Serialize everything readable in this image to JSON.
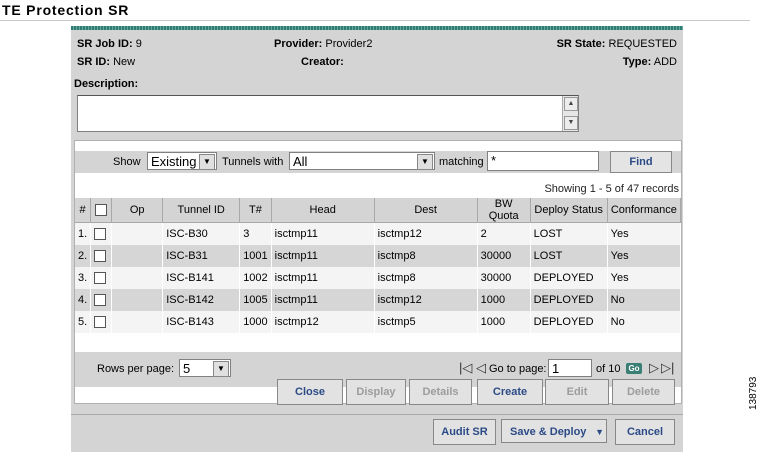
{
  "page": {
    "title": "TE Protection SR",
    "figure_number": "138793"
  },
  "job_info": {
    "job_id_label": "SR Job ID:",
    "job_id": "9",
    "provider_label": "Provider:",
    "provider": "Provider2",
    "state_label": "SR State:",
    "state": "REQUESTED",
    "sr_id_label": "SR ID:",
    "sr_id": "New",
    "creator_label": "Creator:",
    "creator": "",
    "type_label": "Type:",
    "type": "ADD"
  },
  "description": {
    "label": "Description:",
    "value": ""
  },
  "filter": {
    "show_label": "Show",
    "show_value": "Existing",
    "tunnels_label": "Tunnels with",
    "tunnels_value": "All",
    "matching_label": "matching",
    "matching_value": "*",
    "find_label": "Find"
  },
  "records_text": "Showing 1 - 5 of 47 records",
  "table": {
    "headers": [
      "#",
      "",
      "Op",
      "Tunnel ID",
      "T#",
      "Head",
      "Dest",
      "BW Quota",
      "Deploy Status",
      "Conformance"
    ],
    "rows": [
      {
        "num": "1.",
        "op": "",
        "tunnel_id": "ISC-B30",
        "t": "3",
        "head": "isctmp11",
        "dest": "isctmp12",
        "bw": "2",
        "status": "LOST",
        "conformance": "Yes"
      },
      {
        "num": "2.",
        "op": "",
        "tunnel_id": "ISC-B31",
        "t": "1001",
        "head": "isctmp11",
        "dest": "isctmp8",
        "bw": "30000",
        "status": "LOST",
        "conformance": "Yes"
      },
      {
        "num": "3.",
        "op": "",
        "tunnel_id": "ISC-B141",
        "t": "1002",
        "head": "isctmp11",
        "dest": "isctmp8",
        "bw": "30000",
        "status": "DEPLOYED",
        "conformance": "Yes"
      },
      {
        "num": "4.",
        "op": "",
        "tunnel_id": "ISC-B142",
        "t": "1005",
        "head": "isctmp11",
        "dest": "isctmp12",
        "bw": "1000",
        "status": "DEPLOYED",
        "conformance": "No"
      },
      {
        "num": "5.",
        "op": "",
        "tunnel_id": "ISC-B143",
        "t": "1000",
        "head": "isctmp12",
        "dest": "isctmp5",
        "bw": "1000",
        "status": "DEPLOYED",
        "conformance": "No"
      }
    ]
  },
  "pagination": {
    "rows_per_page_label": "Rows per page:",
    "rows_per_page": "5",
    "goto_label": "Go to page:",
    "page": "1",
    "of_text": "of 10",
    "go_label": "Go"
  },
  "table_actions": {
    "close": "Close",
    "display": "Display",
    "details": "Details",
    "create": "Create",
    "edit": "Edit",
    "delete": "Delete"
  },
  "bottom_actions": {
    "audit": "Audit SR",
    "save_deploy": "Save & Deploy",
    "cancel": "Cancel"
  },
  "icons": [
    "dropdown-arrow-icon",
    "first-page-icon",
    "prev-page-icon",
    "next-page-icon",
    "last-page-icon",
    "scroll-up-icon",
    "scroll-down-icon"
  ],
  "colors": {
    "accent": "#2f7d72",
    "button_text": "#2b4a86",
    "disabled_text": "#9c9c9c",
    "panel_bg": "#d4d4d4"
  }
}
